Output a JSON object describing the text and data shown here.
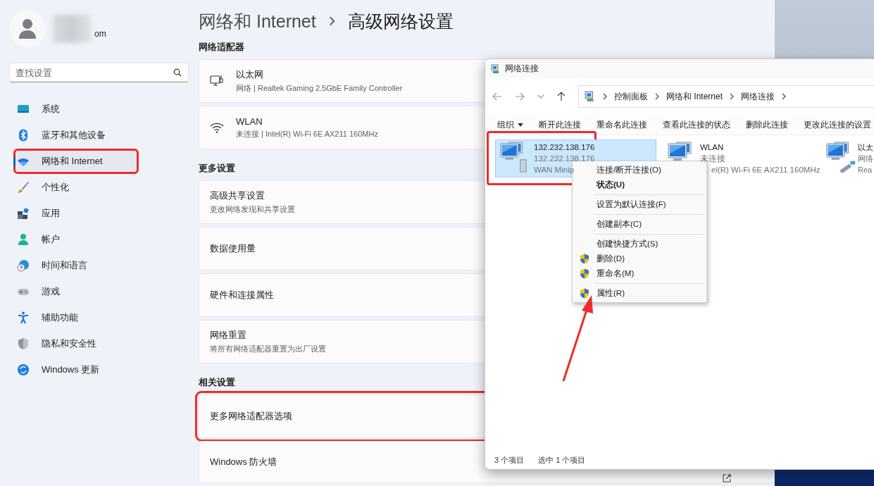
{
  "settings": {
    "profile": {
      "name_tail": "om"
    },
    "search": {
      "placeholder": "查找设置"
    },
    "nav": [
      {
        "label": "系统",
        "selected": false,
        "highlighted": false
      },
      {
        "label": "蓝牙和其他设备",
        "selected": false,
        "highlighted": false
      },
      {
        "label": "网络和 Internet",
        "selected": true,
        "highlighted": true
      },
      {
        "label": "个性化",
        "selected": false,
        "highlighted": false
      },
      {
        "label": "应用",
        "selected": false,
        "highlighted": false
      },
      {
        "label": "帐户",
        "selected": false,
        "highlighted": false
      },
      {
        "label": "时间和语言",
        "selected": false,
        "highlighted": false
      },
      {
        "label": "游戏",
        "selected": false,
        "highlighted": false
      },
      {
        "label": "辅助功能",
        "selected": false,
        "highlighted": false
      },
      {
        "label": "隐私和安全性",
        "selected": false,
        "highlighted": false
      },
      {
        "label": "Windows 更新",
        "selected": false,
        "highlighted": false
      }
    ],
    "breadcrumb": {
      "parent": "网络和 Internet",
      "current": "高级网络设置"
    },
    "sections": [
      {
        "title": "网络适配器",
        "cards": [
          {
            "kind": "adapter",
            "title": "以太网",
            "subtitle": "网络 | Realtek Gaming 2.5GbE Family Controller",
            "highlighted": false
          },
          {
            "kind": "adapter",
            "title": "WLAN",
            "subtitle": "未连接 | Intel(R) Wi-Fi 6E AX211 160MHz",
            "highlighted": false
          }
        ]
      },
      {
        "title": "更多设置",
        "cards": [
          {
            "kind": "setting",
            "title": "高级共享设置",
            "subtitle": "更改网络发现和共享设置",
            "highlighted": false
          },
          {
            "kind": "setting",
            "title": "数据使用量",
            "highlighted": false
          },
          {
            "kind": "setting",
            "title": "硬件和连接属性",
            "highlighted": false
          },
          {
            "kind": "setting",
            "title": "网络重置",
            "subtitle": "将所有网络适配器重置为出厂设置",
            "highlighted": false
          }
        ]
      },
      {
        "title": "相关设置",
        "cards": [
          {
            "kind": "setting",
            "title": "更多网络适配器选项",
            "highlighted": true
          },
          {
            "kind": "link",
            "title": "Windows 防火墙",
            "highlighted": false
          }
        ]
      }
    ]
  },
  "explorer": {
    "title": "网络连接",
    "address": [
      "控制面板",
      "网络和 Internet",
      "网络连接"
    ],
    "organize_menu": "组织",
    "commands": [
      "断开此连接",
      "重命名此连接",
      "查看此连接的状态",
      "删除此连接",
      "更改此连接的设置"
    ],
    "items": [
      {
        "name": "132.232.138.176",
        "line_2": "132.232.138.176",
        "line_3": "WAN Minip",
        "selected": true,
        "highlighted": true
      },
      {
        "name": "WLAN",
        "line_2": "未连接",
        "line_3": "el(R) Wi-Fi 6E AX211 160MHz",
        "selected": false,
        "highlighted": false
      },
      {
        "name": "以太",
        "line_2": "网络",
        "line_3": "Rea",
        "selected": false,
        "highlighted": false
      }
    ],
    "status": [
      "3 个项目",
      "选中 1 个项目"
    ]
  },
  "context_menu": [
    {
      "kind": "item",
      "label": "连接/断开连接(O)"
    },
    {
      "kind": "default",
      "label": "状态(U)"
    },
    {
      "kind": "separator"
    },
    {
      "kind": "item",
      "label": "设置为默认连接(F)"
    },
    {
      "kind": "separator"
    },
    {
      "kind": "item",
      "label": "创建副本(C)"
    },
    {
      "kind": "separator"
    },
    {
      "kind": "item",
      "label": "创建快捷方式(S)"
    },
    {
      "kind": "shield",
      "label": "删除(D)"
    },
    {
      "kind": "shield",
      "label": "重命名(M)"
    },
    {
      "kind": "separator"
    },
    {
      "kind": "shield",
      "label": "属性(R)"
    }
  ]
}
